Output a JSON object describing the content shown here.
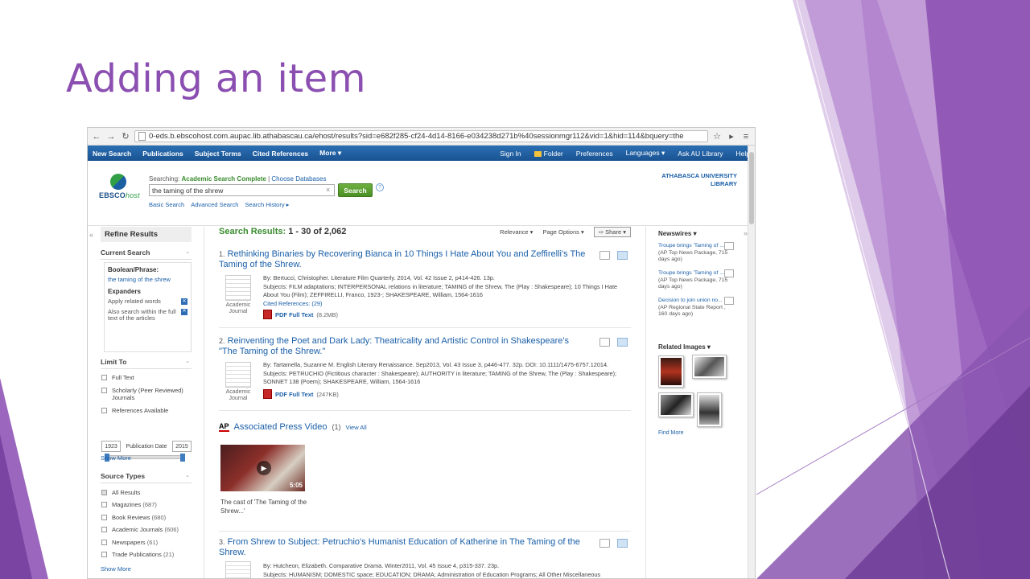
{
  "slide": {
    "title": "Adding an item"
  },
  "browser": {
    "url": "0-eds.b.ebscohost.com.aupac.lib.athabascau.ca/ehost/results?sid=e682f285-cf24-4d14-8166-e034238d271b%40sessionmgr112&vid=1&hid=114&bquery=the"
  },
  "topnav": {
    "left": [
      "New Search",
      "Publications",
      "Subject Terms",
      "Cited References",
      "More ▾"
    ],
    "right": [
      "Sign In",
      "Folder",
      "Preferences",
      "Languages ▾",
      "Ask AU Library",
      "Help"
    ]
  },
  "header": {
    "logo_main": "EBSCO",
    "logo_host": "host",
    "searching_label": "Searching:",
    "database": "Academic Search Complete",
    "separator": "|",
    "choose_db": "Choose Databases",
    "query": "the taming of the shrew",
    "search_button": "Search",
    "help": "?",
    "basic_search": "Basic Search",
    "advanced_search": "Advanced Search",
    "search_history": "Search History ▸",
    "library_line1": "ATHABASCA UNIVERSITY",
    "library_line2": "LIBRARY"
  },
  "left_panel": {
    "refine": "Refine Results",
    "current_search": "Current Search",
    "boolean_label": "Boolean/Phrase:",
    "boolean_value": "the taming of the shrew",
    "expanders_label": "Expanders",
    "expander1": "Apply related words",
    "expander2": "Also search within the full text of the articles",
    "limit_to": "Limit To",
    "limits": [
      "Full Text",
      "Scholarly (Peer Reviewed) Journals",
      "References Available"
    ],
    "date_from": "1923",
    "date_label": "Publication Date",
    "date_to": "2015",
    "show_more": "Show More",
    "source_types": "Source Types",
    "sources": [
      {
        "label": "All Results",
        "count": ""
      },
      {
        "label": "Magazines",
        "count": "(687)"
      },
      {
        "label": "Book Reviews",
        "count": "(680)"
      },
      {
        "label": "Academic Journals",
        "count": "(606)"
      },
      {
        "label": "Newspapers",
        "count": "(61)"
      },
      {
        "label": "Trade Publications",
        "count": "(21)"
      }
    ],
    "show_more2": "Show More"
  },
  "results": {
    "label": "Search Results:",
    "range": "1 - 30 of 2,062",
    "relevance": "Relevance ▾",
    "page_options": "Page Options ▾",
    "share": "Share ▾",
    "items": [
      {
        "num": "1.",
        "title": "Rethinking Binaries by Recovering Bianca in 10 Things I Hate About You and Zeffirelli's The Taming of the Shrew.",
        "byline": "By: Bertucci, Christopher. Literature Film Quarterly. 2014, Vol. 42 Issue 2, p414-426. 13p.",
        "subjects": "Subjects: FILM adaptations; INTERPERSONAL relations in literature; TAMING of the Shrew, The (Play : Shakespeare); 10 Things I Hate About You (Film); ZEFFIRELLI, Franco, 1923-; SHAKESPEARE, William, 1564-1616",
        "cited": "Cited References: (29)",
        "pdf": "PDF Full Text",
        "size": "(8.2MB)",
        "type": "Academic Journal"
      },
      {
        "num": "2.",
        "title": "Reinventing the Poet and Dark Lady: Theatricality and Artistic Control in Shakespeare's \"The Taming of the Shrew.\"",
        "byline": "By: Tartamella, Suzanne M. English Literary Renaissance. Sep2013, Vol. 43 Issue 3, p446-477. 32p. DOI: 10.1111/1475-6757.12014.",
        "subjects": "Subjects: PETRUCHIO (Fictitious character : Shakespeare); AUTHORITY in literature; TAMING of the Shrew, The (Play : Shakespeare); SONNET 138 (Poem); SHAKESPEARE, William, 1564-1616",
        "pdf": "PDF Full Text",
        "size": "(247KB)",
        "type": "Academic Journal"
      },
      {
        "num": "3.",
        "title": "From Shrew to Subject: Petruchio's Humanist Education of Katherine in The Taming of the Shrew.",
        "byline": "By: Hutcheon, Elizabeth. Comparative Drama. Winter2011, Vol. 45 Issue 4, p315-337. 23p.",
        "subjects": "Subjects: HUMANISM; DOMESTIC space; EDUCATION; DRAMA; Administration of Education Programs; All Other Miscellaneous"
      }
    ],
    "ap_logo": "AP",
    "ap_title": "Associated Press Video",
    "ap_count": "(1)",
    "ap_view_all": "View All",
    "video_duration": "5:05",
    "video_caption": "The cast of 'The Taming of the Shrew...'"
  },
  "right_panel": {
    "newswires": "Newswires ▾",
    "news": [
      {
        "link": "Troupe brings 'Taming of ...",
        "source": "(AP Top News Package, 715 days ago)"
      },
      {
        "link": "Troupe brings 'Taming of ...",
        "source": "(AP Top News Package, 715 days ago)"
      },
      {
        "link": "Decision to join union no...",
        "source": "(AP Regional State Report , 160 days ago)"
      }
    ],
    "related_images": "Related Images ▾",
    "find_more": "Find More"
  },
  "colors": {
    "title_purple": "#8a4fb0",
    "nav_blue": "#1f5c99",
    "link_blue": "#1a5fa8",
    "result_green": "#3a8c2f"
  }
}
